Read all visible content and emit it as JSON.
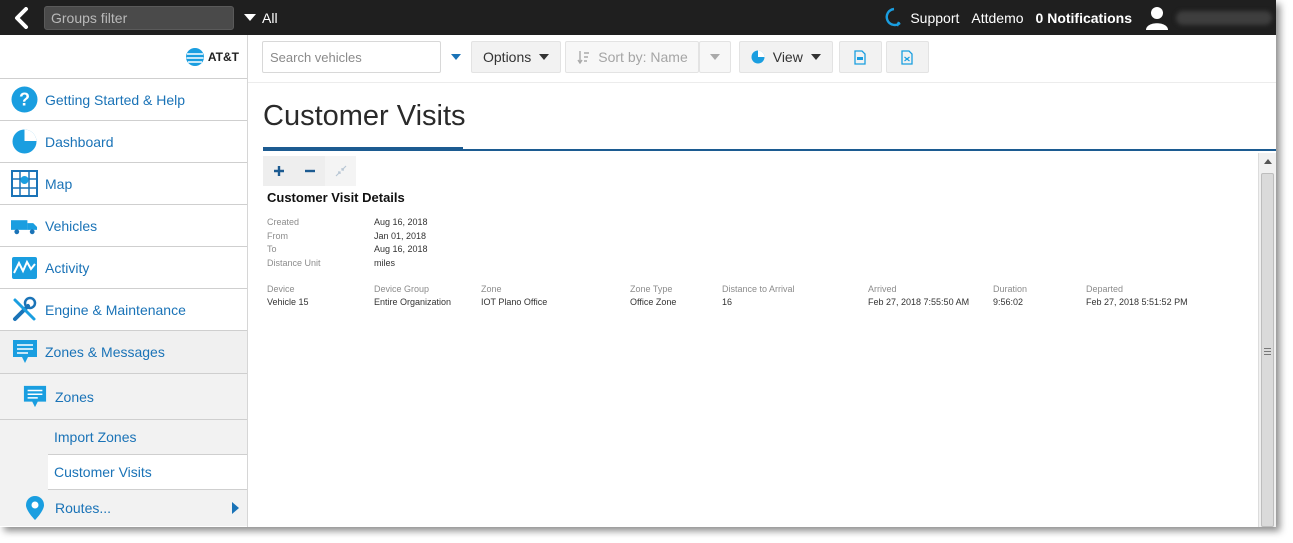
{
  "topbar": {
    "groups_filter_placeholder": "Groups filter",
    "groups_value": "All",
    "support": "Support",
    "username": "Attdemo",
    "notifications": "0 Notifications"
  },
  "sidebar": {
    "logo_text": "AT&T",
    "items": [
      {
        "label": "Getting Started & Help",
        "icon": "help-icon"
      },
      {
        "label": "Dashboard",
        "icon": "pie-chart-icon"
      },
      {
        "label": "Map",
        "icon": "map-icon"
      },
      {
        "label": "Vehicles",
        "icon": "truck-icon"
      },
      {
        "label": "Activity",
        "icon": "activity-icon"
      },
      {
        "label": "Engine & Maintenance",
        "icon": "wrench-icon"
      },
      {
        "label": "Zones & Messages",
        "icon": "message-icon"
      }
    ],
    "sub": {
      "zones": "Zones",
      "import_zones": "Import Zones",
      "customer_visits": "Customer Visits",
      "routes": "Routes..."
    }
  },
  "toolbar": {
    "search_placeholder": "Search vehicles",
    "options": "Options",
    "sort": "Sort by: Name",
    "view": "View"
  },
  "page": {
    "title": "Customer Visits"
  },
  "report": {
    "heading": "Customer Visit Details",
    "meta": [
      {
        "label": "Created",
        "value": "Aug 16, 2018"
      },
      {
        "label": "From",
        "value": "Jan 01, 2018"
      },
      {
        "label": "To",
        "value": "Aug 16, 2018"
      },
      {
        "label": "Distance Unit",
        "value": "miles"
      }
    ],
    "columns": [
      "Device",
      "Device Group",
      "Zone",
      "Zone Type",
      "Distance to Arrival",
      "Arrived",
      "Duration",
      "Departed"
    ],
    "rows": [
      [
        "Vehicle 15",
        "Entire Organization",
        "IOT Plano Office",
        "Office Zone",
        "16",
        "Feb 27, 2018 7:55:50 AM",
        "9:56:02",
        "Feb 27, 2018 5:51:52 PM"
      ]
    ]
  },
  "colors": {
    "accent_blue": "#1a73b7",
    "topbar_bg": "#1f1f1f",
    "title_rule": "#1c5b91"
  }
}
